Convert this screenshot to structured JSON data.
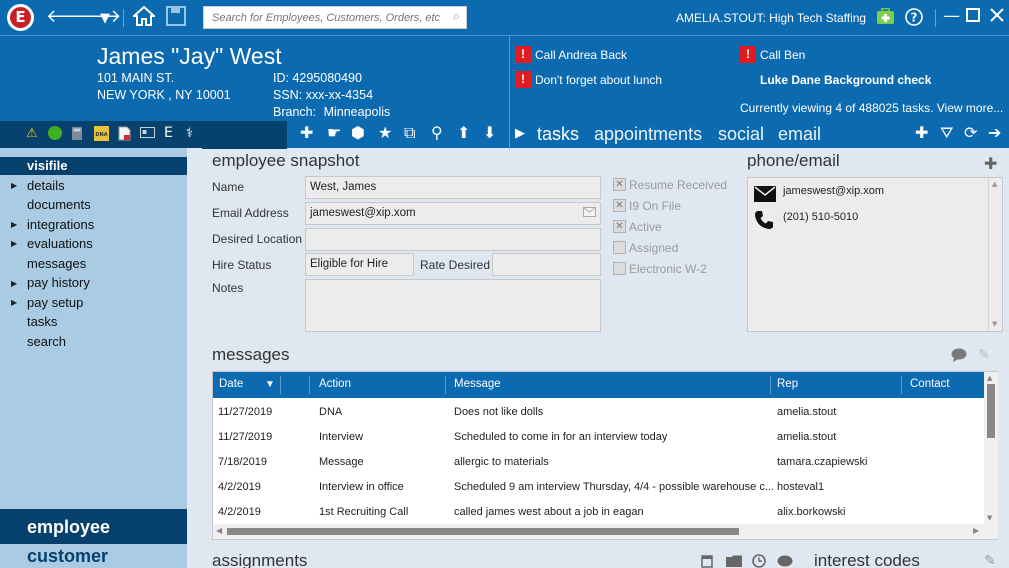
{
  "titlebar": {
    "logo_letter": "E",
    "search_placeholder": "Search for Employees, Customers, Orders, etc.",
    "user": "AMELIA.STOUT: High Tech Staffing",
    "icons": [
      "back-arrow-icon",
      "forward-arrow-icon",
      "dropdown-caret-icon",
      "home-icon",
      "save-icon",
      "search-icon",
      "first-aid-kit-icon",
      "help-icon",
      "minimize-icon",
      "maximize-icon",
      "close-icon"
    ]
  },
  "employee": {
    "name": "James \"Jay\" West",
    "address1": "101 MAIN ST.",
    "address2": "NEW YORK , NY 10001",
    "id": "ID: 4295080490",
    "ssn": "SSN: xxx-xx-4354",
    "branch_label": "Branch:",
    "branch": "Minneapolis"
  },
  "alerts": {
    "bang": "!",
    "items": [
      "Call Andrea Back",
      "Call Ben",
      "Don't forget about lunch",
      "Luke Dane Background check"
    ],
    "viewing": "Currently viewing 4 of 488025 tasks. View more..."
  },
  "tabs": [
    "tasks",
    "appointments",
    "social",
    "email"
  ],
  "sidebar": {
    "items": [
      "visifile",
      "details",
      "documents",
      "integrations",
      "evaluations",
      "messages",
      "pay history",
      "pay setup",
      "tasks",
      "search"
    ],
    "bottom_items": [
      "employee",
      "customer"
    ]
  },
  "snapshot": {
    "title": "employee snapshot",
    "name_label": "Name",
    "name_value": "West, James",
    "email_label": "Email Address",
    "email_value": "jameswest@xip.xom",
    "desired_location_label": "Desired Location",
    "desired_location_value": "",
    "hire_status_label": "Hire Status",
    "hire_status_value": "Eligible for Hire",
    "rate_desired_label": "Rate Desired",
    "rate_desired_value": "",
    "notes_label": "Notes",
    "notes_value": "",
    "checkboxes": [
      {
        "label": "Resume Received",
        "checked": true
      },
      {
        "label": "I9 On File",
        "checked": true
      },
      {
        "label": "Active",
        "checked": true
      },
      {
        "label": "Assigned",
        "checked": false
      },
      {
        "label": "Electronic W-2",
        "checked": false
      }
    ],
    "check_mark": "✕"
  },
  "phone_email": {
    "title": "phone/email",
    "email": "jameswest@xip.xom",
    "phone": "(201) 510-5010"
  },
  "messages": {
    "title": "messages",
    "columns": [
      "Date",
      "Action",
      "Message",
      "Rep",
      "Contact"
    ],
    "rows": [
      [
        "11/27/2019",
        "DNA",
        "Does not like dolls",
        "amelia.stout",
        ""
      ],
      [
        "11/27/2019",
        "Interview",
        "Scheduled to come in for an interview today",
        "amelia.stout",
        ""
      ],
      [
        "7/18/2019",
        "Message",
        "allergic to materials",
        "tamara.czapiewski",
        ""
      ],
      [
        "4/2/2019",
        "Interview in office",
        "Scheduled 9 am interview Thursday, 4/4 - possible warehouse c...",
        "hosteval1",
        ""
      ],
      [
        "4/2/2019",
        "1st Recruiting Call",
        "called james west about a job in eagan",
        "alix.borkowski",
        ""
      ]
    ]
  },
  "bottom": {
    "assignments_title": "assignments",
    "interest_codes_title": "interest codes"
  },
  "colors": {
    "header_blue": "#0b6ab0",
    "dark_navy": "#06416d",
    "sidebar_blue": "#a9cbe3",
    "alert_red": "#e11b22"
  }
}
